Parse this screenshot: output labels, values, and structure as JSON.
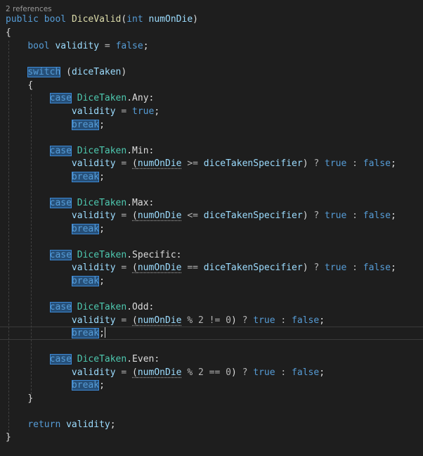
{
  "codelens": "2 references",
  "tokens": {
    "public": "public",
    "bool": "bool",
    "int": "int",
    "switch": "switch",
    "case": "case",
    "break": "break",
    "true": "true",
    "false": "false",
    "return": "return",
    "method_name": "DiceValid",
    "param": "numOnDie",
    "local": "validity",
    "switch_subject": "diceTaken",
    "enum_type": "DiceTaken",
    "specifier": "diceTakenSpecifier",
    "members": [
      "Any",
      "Min",
      "Max",
      "Specific",
      "Odd",
      "Even"
    ],
    "ops": {
      "ge": ">=",
      "le": "<=",
      "eq": "==",
      "ne": "!=",
      "mod": "%"
    },
    "nums": {
      "two": "2",
      "zero": "0"
    }
  },
  "colors": {
    "background": "#1e1e1e",
    "keyword": "#569cd6",
    "type": "#4ec9b0",
    "method": "#dcdcaa",
    "identifier": "#9cdcfe",
    "highlight": "#264f78"
  }
}
